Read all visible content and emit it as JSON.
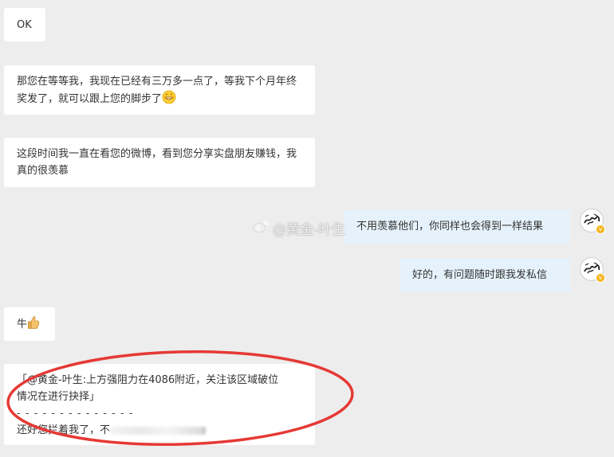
{
  "messages": [
    {
      "side": "left",
      "text": "OK"
    },
    {
      "side": "left",
      "text": "那您在等等我，我现在已经有三万多一点了，等我下个月年终奖发了，就可以跟上您的脚步了",
      "emoji": "grinning-face-emoji"
    },
    {
      "side": "left",
      "text": "这段时间我一直在看您的微博，看到您分享实盘朋友赚钱，我真的很羡慕"
    },
    {
      "side": "right",
      "text": "不用羡慕他们，你同样也会得到一样结果"
    },
    {
      "side": "right",
      "text": "好的，有问题随时跟我发私信"
    },
    {
      "side": "left",
      "text": "牛",
      "emoji": "thumbs-up-emoji"
    },
    {
      "side": "left",
      "quote_line1": "「@黄金-叶生:上方强阻力在4086附近，关注该区域破位",
      "quote_line2": "情况在进行抉择」",
      "separator": "- - - - - - - - - - - - - -",
      "reply_text": "还好您拦着我了，不"
    }
  ],
  "watermark": {
    "text": "@黄金-叶生",
    "icon": "weibo-icon"
  },
  "annotation": {
    "color": "#e53935",
    "shape": "ellipse"
  },
  "colors": {
    "background": "#ededed",
    "bubble_left": "#ffffff",
    "bubble_right": "#e6f2fb",
    "verified_badge": "#f4b41a"
  }
}
